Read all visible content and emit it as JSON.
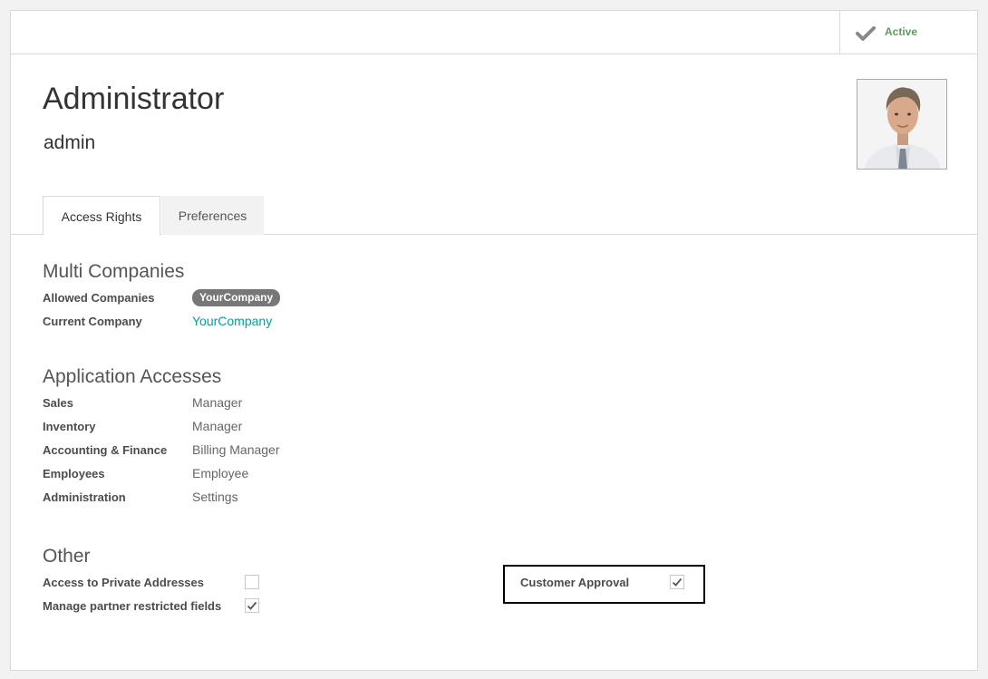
{
  "status": {
    "active_label": "Active",
    "active_icon": "check-icon"
  },
  "record": {
    "name": "Administrator",
    "login": "admin"
  },
  "tabs": [
    {
      "label": "Access Rights"
    },
    {
      "label": "Preferences"
    }
  ],
  "multi_companies": {
    "title": "Multi Companies",
    "allowed_companies_label": "Allowed Companies",
    "allowed_companies_tag": "YourCompany",
    "current_company_label": "Current Company",
    "current_company_value": "YourCompany"
  },
  "application_accesses": {
    "title": "Application Accesses",
    "rows": [
      {
        "label": "Sales",
        "value": "Manager"
      },
      {
        "label": "Inventory",
        "value": "Manager"
      },
      {
        "label": "Accounting & Finance",
        "value": "Billing Manager"
      },
      {
        "label": "Employees",
        "value": "Employee"
      },
      {
        "label": "Administration",
        "value": "Settings"
      }
    ]
  },
  "other": {
    "title": "Other",
    "access_private_addresses_label": "Access to Private Addresses",
    "access_private_addresses_checked": false,
    "manage_partner_label": "Manage partner restricted fields",
    "manage_partner_checked": true,
    "customer_approval_label": "Customer Approval",
    "customer_approval_checked": true
  },
  "colors": {
    "active_green": "#5d9b5d",
    "link_teal": "#00a09d",
    "badge_gray": "#777777"
  }
}
